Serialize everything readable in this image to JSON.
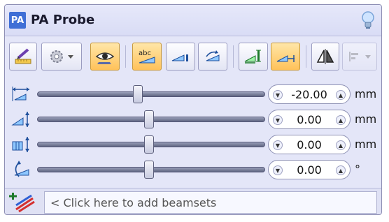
{
  "window": {
    "badge": "PA",
    "title": "PA Probe"
  },
  "toolbar": {
    "buttons": [
      {
        "name": "ruler-edit",
        "icon": "ruler-pencil-icon",
        "state": "normal"
      },
      {
        "name": "settings",
        "icon": "gear-dropdown-icon",
        "state": "normal"
      },
      {
        "name": "view",
        "icon": "eye-icon",
        "state": "on"
      },
      {
        "name": "labels",
        "icon": "abc-label-icon",
        "state": "on"
      },
      {
        "name": "probe-aperture",
        "icon": "probe-wedge-icon",
        "state": "normal"
      },
      {
        "name": "probe-rotate",
        "icon": "probe-rotate-icon",
        "state": "normal"
      },
      {
        "name": "aperture-left",
        "icon": "aperture-left-icon",
        "state": "normal"
      },
      {
        "name": "aperture-right",
        "icon": "aperture-right-icon",
        "state": "on"
      },
      {
        "name": "mirror",
        "icon": "mirror-icon",
        "state": "normal"
      },
      {
        "name": "align",
        "icon": "align-dropdown-icon",
        "state": "disabled"
      }
    ]
  },
  "sliders": [
    {
      "name": "index-offset",
      "icon": "index-offset-icon",
      "value": "-20.00",
      "unit": "mm",
      "level": 0.44
    },
    {
      "name": "wedge-height",
      "icon": "wedge-height-icon",
      "value": "0.00",
      "unit": "mm",
      "level": 0.49
    },
    {
      "name": "element-spacing",
      "icon": "element-spacing-icon",
      "value": "0.00",
      "unit": "mm",
      "level": 0.49
    },
    {
      "name": "skew-angle",
      "icon": "skew-angle-icon",
      "value": "0.00",
      "unit": "°",
      "level": 0.49
    }
  ],
  "footer": {
    "add_placeholder": "< Click here to add beamsets",
    "add_icon": "add-beamset-icon"
  },
  "colors": {
    "panel_bg": "#e4e6f8",
    "active_button": "#ffc25a",
    "accent": "#3f6fd6"
  }
}
